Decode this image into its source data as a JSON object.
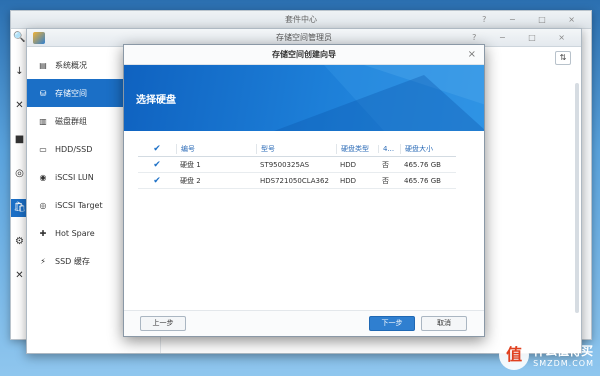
{
  "package_center": {
    "title": "套件中心",
    "controls": "? − □ ×",
    "left_glyphs": [
      "🔍",
      "↓",
      "✕",
      "■",
      "◎",
      "🛍",
      "⚙",
      "✕"
    ]
  },
  "storage_manager": {
    "title": "存储空间管理员",
    "controls": "? − □ ×",
    "sort_icon": "sort-icon",
    "sidebar": [
      {
        "label": "系统概况",
        "icon": "overview-icon",
        "active": false
      },
      {
        "label": "存储空间",
        "icon": "storage-icon",
        "active": true
      },
      {
        "label": "磁盘群组",
        "icon": "disk-group-icon",
        "active": false
      },
      {
        "label": "HDD/SSD",
        "icon": "hdd-icon",
        "active": false
      },
      {
        "label": "iSCSI LUN",
        "icon": "lun-icon",
        "active": false
      },
      {
        "label": "iSCSI Target",
        "icon": "target-icon",
        "active": false
      },
      {
        "label": "Hot Spare",
        "icon": "hot-spare-icon",
        "active": false
      },
      {
        "label": "SSD 缓存",
        "icon": "ssd-cache-icon",
        "active": false
      }
    ]
  },
  "wizard": {
    "title": "存储空间创建向导",
    "close": "×",
    "banner_title": "选择硬盘",
    "columns": [
      "编号",
      "型号",
      "硬盘类型",
      "4...",
      "硬盘大小"
    ],
    "rows": [
      {
        "checked": true,
        "id": "硬盘 1",
        "model": "ST9500325AS",
        "type": "HDD",
        "col4": "否",
        "size": "465.76 GB"
      },
      {
        "checked": true,
        "id": "硬盘 2",
        "model": "HDS721050CLA362",
        "type": "HDD",
        "col4": "否",
        "size": "465.76 GB"
      }
    ],
    "buttons": {
      "prev": "上一步",
      "next": "下一步",
      "cancel": "取消"
    }
  },
  "watermark": {
    "logo": "值",
    "line1": "什么值得买",
    "line2": "SMZDM.COM"
  },
  "colors": {
    "accent": "#1b6fc6",
    "banner": "#1d7fd8"
  }
}
